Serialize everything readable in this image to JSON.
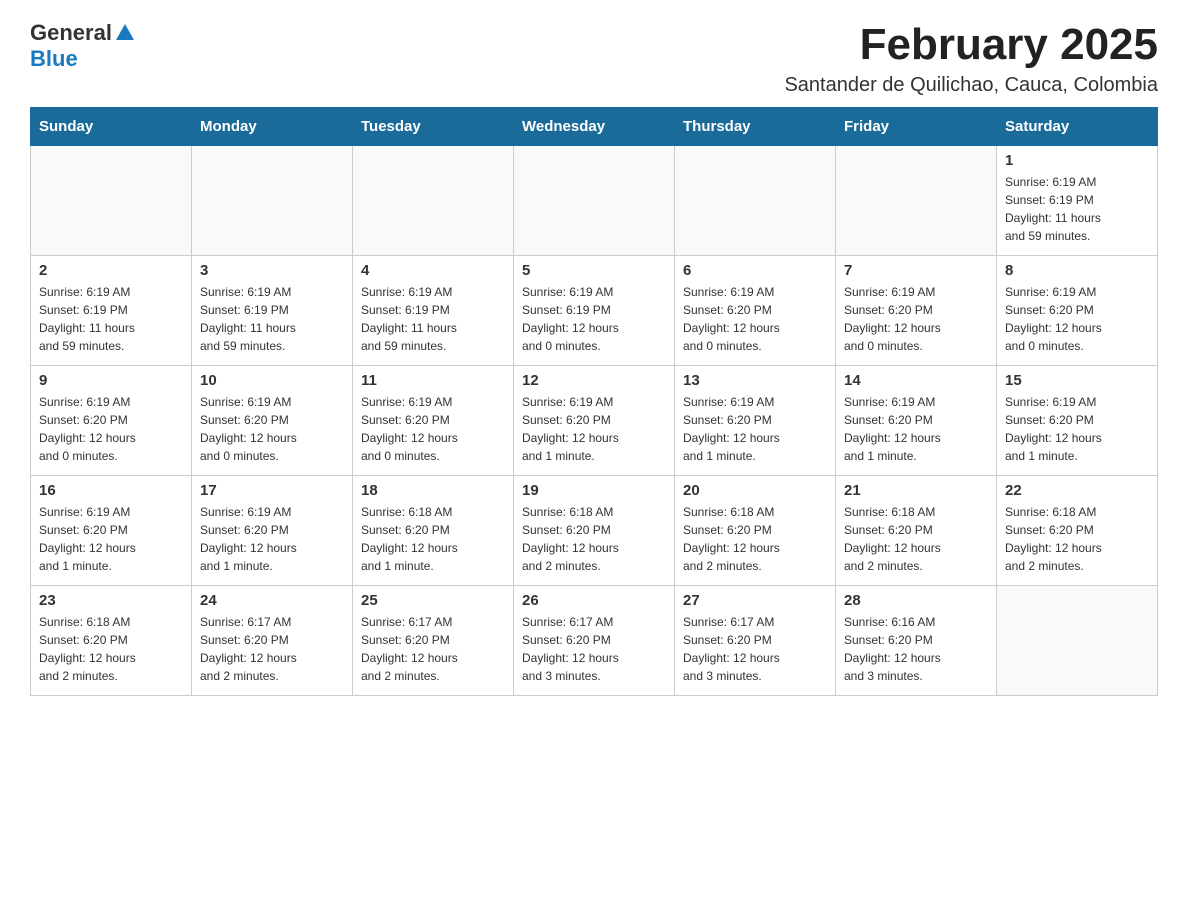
{
  "logo": {
    "general": "General",
    "blue": "Blue"
  },
  "title": "February 2025",
  "subtitle": "Santander de Quilichao, Cauca, Colombia",
  "weekdays": [
    "Sunday",
    "Monday",
    "Tuesday",
    "Wednesday",
    "Thursday",
    "Friday",
    "Saturday"
  ],
  "weeks": [
    [
      {
        "day": "",
        "info": ""
      },
      {
        "day": "",
        "info": ""
      },
      {
        "day": "",
        "info": ""
      },
      {
        "day": "",
        "info": ""
      },
      {
        "day": "",
        "info": ""
      },
      {
        "day": "",
        "info": ""
      },
      {
        "day": "1",
        "info": "Sunrise: 6:19 AM\nSunset: 6:19 PM\nDaylight: 11 hours\nand 59 minutes."
      }
    ],
    [
      {
        "day": "2",
        "info": "Sunrise: 6:19 AM\nSunset: 6:19 PM\nDaylight: 11 hours\nand 59 minutes."
      },
      {
        "day": "3",
        "info": "Sunrise: 6:19 AM\nSunset: 6:19 PM\nDaylight: 11 hours\nand 59 minutes."
      },
      {
        "day": "4",
        "info": "Sunrise: 6:19 AM\nSunset: 6:19 PM\nDaylight: 11 hours\nand 59 minutes."
      },
      {
        "day": "5",
        "info": "Sunrise: 6:19 AM\nSunset: 6:19 PM\nDaylight: 12 hours\nand 0 minutes."
      },
      {
        "day": "6",
        "info": "Sunrise: 6:19 AM\nSunset: 6:20 PM\nDaylight: 12 hours\nand 0 minutes."
      },
      {
        "day": "7",
        "info": "Sunrise: 6:19 AM\nSunset: 6:20 PM\nDaylight: 12 hours\nand 0 minutes."
      },
      {
        "day": "8",
        "info": "Sunrise: 6:19 AM\nSunset: 6:20 PM\nDaylight: 12 hours\nand 0 minutes."
      }
    ],
    [
      {
        "day": "9",
        "info": "Sunrise: 6:19 AM\nSunset: 6:20 PM\nDaylight: 12 hours\nand 0 minutes."
      },
      {
        "day": "10",
        "info": "Sunrise: 6:19 AM\nSunset: 6:20 PM\nDaylight: 12 hours\nand 0 minutes."
      },
      {
        "day": "11",
        "info": "Sunrise: 6:19 AM\nSunset: 6:20 PM\nDaylight: 12 hours\nand 0 minutes."
      },
      {
        "day": "12",
        "info": "Sunrise: 6:19 AM\nSunset: 6:20 PM\nDaylight: 12 hours\nand 1 minute."
      },
      {
        "day": "13",
        "info": "Sunrise: 6:19 AM\nSunset: 6:20 PM\nDaylight: 12 hours\nand 1 minute."
      },
      {
        "day": "14",
        "info": "Sunrise: 6:19 AM\nSunset: 6:20 PM\nDaylight: 12 hours\nand 1 minute."
      },
      {
        "day": "15",
        "info": "Sunrise: 6:19 AM\nSunset: 6:20 PM\nDaylight: 12 hours\nand 1 minute."
      }
    ],
    [
      {
        "day": "16",
        "info": "Sunrise: 6:19 AM\nSunset: 6:20 PM\nDaylight: 12 hours\nand 1 minute."
      },
      {
        "day": "17",
        "info": "Sunrise: 6:19 AM\nSunset: 6:20 PM\nDaylight: 12 hours\nand 1 minute."
      },
      {
        "day": "18",
        "info": "Sunrise: 6:18 AM\nSunset: 6:20 PM\nDaylight: 12 hours\nand 1 minute."
      },
      {
        "day": "19",
        "info": "Sunrise: 6:18 AM\nSunset: 6:20 PM\nDaylight: 12 hours\nand 2 minutes."
      },
      {
        "day": "20",
        "info": "Sunrise: 6:18 AM\nSunset: 6:20 PM\nDaylight: 12 hours\nand 2 minutes."
      },
      {
        "day": "21",
        "info": "Sunrise: 6:18 AM\nSunset: 6:20 PM\nDaylight: 12 hours\nand 2 minutes."
      },
      {
        "day": "22",
        "info": "Sunrise: 6:18 AM\nSunset: 6:20 PM\nDaylight: 12 hours\nand 2 minutes."
      }
    ],
    [
      {
        "day": "23",
        "info": "Sunrise: 6:18 AM\nSunset: 6:20 PM\nDaylight: 12 hours\nand 2 minutes."
      },
      {
        "day": "24",
        "info": "Sunrise: 6:17 AM\nSunset: 6:20 PM\nDaylight: 12 hours\nand 2 minutes."
      },
      {
        "day": "25",
        "info": "Sunrise: 6:17 AM\nSunset: 6:20 PM\nDaylight: 12 hours\nand 2 minutes."
      },
      {
        "day": "26",
        "info": "Sunrise: 6:17 AM\nSunset: 6:20 PM\nDaylight: 12 hours\nand 3 minutes."
      },
      {
        "day": "27",
        "info": "Sunrise: 6:17 AM\nSunset: 6:20 PM\nDaylight: 12 hours\nand 3 minutes."
      },
      {
        "day": "28",
        "info": "Sunrise: 6:16 AM\nSunset: 6:20 PM\nDaylight: 12 hours\nand 3 minutes."
      },
      {
        "day": "",
        "info": ""
      }
    ]
  ]
}
